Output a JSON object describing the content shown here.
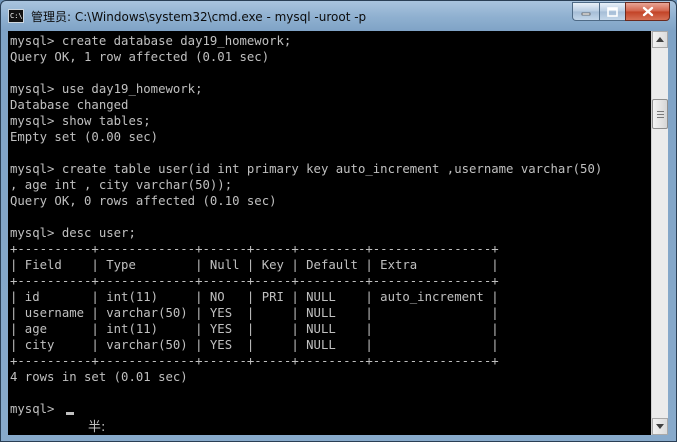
{
  "window": {
    "title": "管理员: C:\\Windows\\system32\\cmd.exe - mysql  -uroot -p",
    "app_icon_text": "C:\\"
  },
  "console": {
    "lines": [
      "mysql> create database day19_homework;",
      "Query OK, 1 row affected (0.01 sec)",
      "",
      "mysql> use day19_homework;",
      "Database changed",
      "mysql> show tables;",
      "Empty set (0.00 sec)",
      "",
      "mysql> create table user(id int primary key auto_increment ,username varchar(50)",
      ", age int , city varchar(50));",
      "Query OK, 0 rows affected (0.10 sec)",
      "",
      "mysql> desc user;",
      "+----------+-------------+------+-----+---------+----------------+",
      "| Field    | Type        | Null | Key | Default | Extra          |",
      "+----------+-------------+------+-----+---------+----------------+",
      "| id       | int(11)     | NO   | PRI | NULL    | auto_increment |",
      "| username | varchar(50) | YES  |     | NULL    |                |",
      "| age      | int(11)     | YES  |     | NULL    |                |",
      "| city     | varchar(50) | YES  |     | NULL    |                |",
      "+----------+-------------+------+-----+---------+----------------+",
      "4 rows in set (0.01 sec)",
      "",
      "mysql> "
    ],
    "ime_indicator": "半:"
  },
  "colors": {
    "console_bg": "#000000",
    "console_text": "#c0c0c0",
    "titlebar": "#8fb0d0",
    "close_button": "#c24226"
  },
  "icons": {
    "minimize": "minimize-icon",
    "maximize": "maximize-icon",
    "close": "close-icon",
    "scroll_up": "arrow-up-icon",
    "scroll_down": "arrow-down-icon"
  }
}
